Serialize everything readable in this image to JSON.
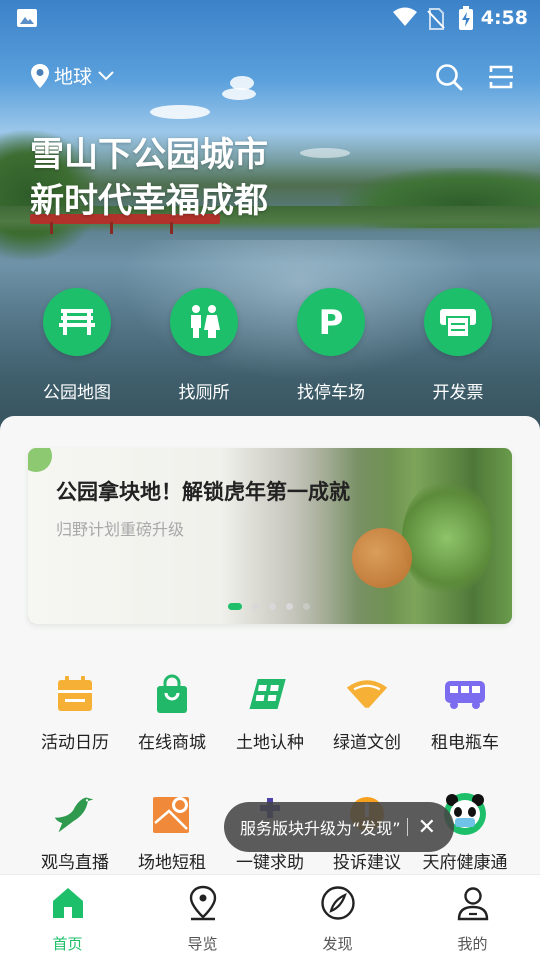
{
  "status_bar": {
    "time": "4:58"
  },
  "header": {
    "location": "地球",
    "slogan_line1": "雪山下公园城市",
    "slogan_line2": "新时代幸福成都"
  },
  "quick_actions": [
    {
      "label": "公园地图",
      "icon": "bench-icon"
    },
    {
      "label": "找厕所",
      "icon": "restroom-icon"
    },
    {
      "label": "找停车场",
      "icon": "parking-icon"
    },
    {
      "label": "开发票",
      "icon": "invoice-printer-icon"
    }
  ],
  "banner": {
    "title": "公园拿块地！解锁虎年第一成就",
    "subtitle": "归野计划重磅升级",
    "dots_total": 5,
    "dots_active": 1
  },
  "services_row1": [
    {
      "label": "活动日历",
      "icon": "calendar-icon",
      "color": "#f6b035"
    },
    {
      "label": "在线商城",
      "icon": "shopping-bag-icon",
      "color": "#21b86a"
    },
    {
      "label": "土地认种",
      "icon": "farmland-icon",
      "color": "#21b86a"
    },
    {
      "label": "绿道文创",
      "icon": "fan-icon",
      "color": "#f6b035"
    },
    {
      "label": "租电瓶车",
      "icon": "bus-icon",
      "color": "#7b6cf0"
    }
  ],
  "services_row2": [
    {
      "label": "观鸟直播",
      "icon": "bird-icon",
      "color": "#2f9a4e"
    },
    {
      "label": "场地短租",
      "icon": "map-pin-icon",
      "color": "#f08a3a"
    },
    {
      "label": "一键求助",
      "icon": "help-plus-icon",
      "color": "#4e43a8"
    },
    {
      "label": "投诉建议",
      "icon": "complaint-icon",
      "color": "#f6a020"
    },
    {
      "label": "天府健康通",
      "icon": "panda-icon",
      "color": "#1dbf6a"
    }
  ],
  "toast": {
    "text": "服务版块升级为“发现”"
  },
  "bottom_nav": [
    {
      "label": "首页",
      "icon": "home-icon",
      "active": true
    },
    {
      "label": "导览",
      "icon": "location-icon",
      "active": false
    },
    {
      "label": "发现",
      "icon": "compass-icon",
      "active": false
    },
    {
      "label": "我的",
      "icon": "user-icon",
      "active": false
    }
  ],
  "colors": {
    "accent": "#1dbf6a",
    "text_primary": "#222222",
    "text_muted": "#a8a8a8"
  }
}
